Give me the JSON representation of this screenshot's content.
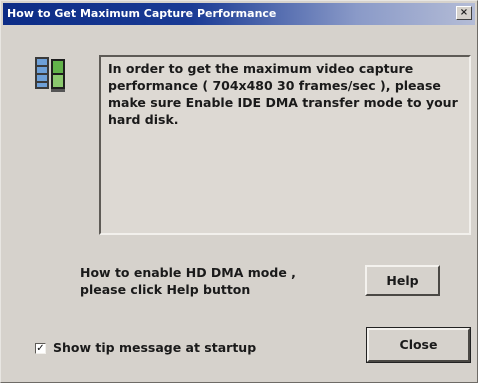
{
  "window": {
    "title": "How to Get Maximum Capture Performance",
    "close_glyph": "×"
  },
  "icon": "capture-card-icon",
  "message": {
    "text": "In order to get the maximum video capture performance ( 704x480 30 frames/sec ), please make sure Enable IDE DMA transfer mode to your hard disk."
  },
  "hint": {
    "line1": "How to enable HD DMA mode ,",
    "line2": "please click Help button"
  },
  "buttons": {
    "help_label": "Help",
    "close_label": "Close"
  },
  "startup_tip": {
    "checked": true,
    "check_glyph": "✓",
    "label": "Show tip message at startup"
  },
  "colors": {
    "titlebar_start": "#0c2c86",
    "titlebar_end": "#b4bcd6",
    "dialog_face": "#d6d2cc"
  }
}
